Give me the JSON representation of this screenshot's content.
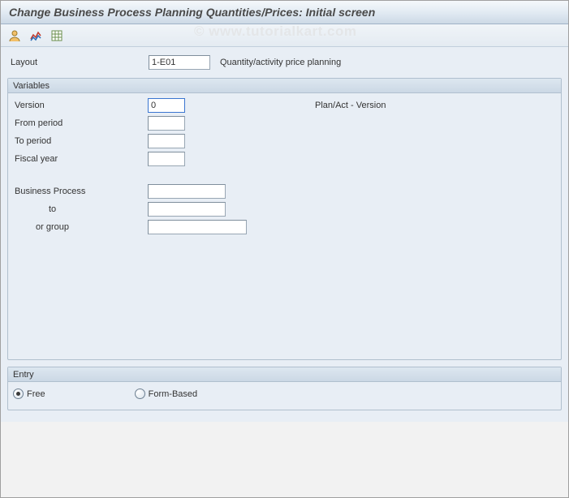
{
  "title": "Change Business Process Planning Quantities/Prices: Initial screen",
  "watermark": "© www.tutorialkart.com",
  "toolbar": {
    "icon1": "user-settings-icon",
    "icon2": "chart-icon",
    "icon3": "spreadsheet-icon"
  },
  "layout": {
    "label": "Layout",
    "value": "1-E01",
    "desc": "Quantity/activity price planning"
  },
  "variables": {
    "title": "Variables",
    "version": {
      "label": "Version",
      "value": "0",
      "desc": "Plan/Act - Version"
    },
    "from_period": {
      "label": "From period",
      "value": ""
    },
    "to_period": {
      "label": "To period",
      "value": ""
    },
    "fiscal_year": {
      "label": "Fiscal year",
      "value": ""
    },
    "business_process": {
      "label": "Business Process",
      "value": ""
    },
    "to": {
      "label": "to",
      "value": ""
    },
    "or_group": {
      "label": "or group",
      "value": ""
    }
  },
  "entry": {
    "title": "Entry",
    "free": "Free",
    "form_based": "Form-Based",
    "selected": "free"
  }
}
